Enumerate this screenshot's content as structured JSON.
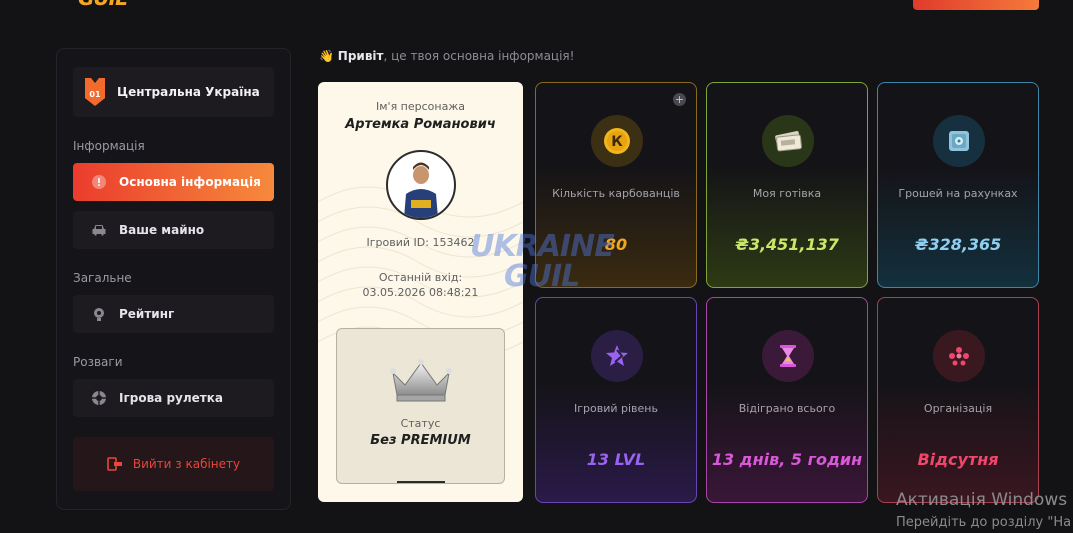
{
  "header": {
    "logo_text": "GUIL"
  },
  "sidebar": {
    "region": {
      "badge": "01",
      "name": "Центральна Україна"
    },
    "sections": [
      {
        "title": "Інформація"
      },
      {
        "title": "Загальне"
      },
      {
        "title": "Розваги"
      }
    ],
    "items": [
      {
        "label": "Основна інформація"
      },
      {
        "label": "Ваше майно"
      },
      {
        "label": "Рейтинг"
      },
      {
        "label": "Ігрова рулетка"
      }
    ],
    "logout_label": "Вийти з кабінету"
  },
  "greeting": {
    "emoji": "👋",
    "bold": "Привіт",
    "rest": ", це твоя основна інформація!"
  },
  "profile": {
    "name_label": "Ім'я персонажа",
    "name": "Артемка Романович",
    "game_id": "Ігровий ID: 153462",
    "last_login_label": "Останній вхід:",
    "last_login": "03.05.2026 08:48:21",
    "status_label": "Статус",
    "status": "Без PREMIUM"
  },
  "cards": [
    {
      "title": "Кількість карбованців",
      "value": "80",
      "icon": "coin-icon",
      "color": "#f2a71e"
    },
    {
      "title": "Моя готівка",
      "value": "₴3,451,137",
      "icon": "cash-icon",
      "color": "#c9e86a"
    },
    {
      "title": "Грошей на рахунках",
      "value": "₴328,365",
      "icon": "safe-icon",
      "color": "#8fd0f2"
    },
    {
      "title": "Ігровий рівень",
      "value": "13 LVL",
      "icon": "star-icon",
      "color": "#9a62f0"
    },
    {
      "title": "Відіграно всього",
      "value": "13 днів, 5 годин",
      "icon": "hourglass-icon",
      "color": "#d957d9"
    },
    {
      "title": "Організація",
      "value": "Відсутня",
      "icon": "organization-icon",
      "color": "#f0466c"
    }
  ],
  "watermark": {
    "line1": "UKRAINE",
    "line2": "GUIL"
  },
  "windows_activation": {
    "title": "Активація Windows",
    "subtitle": "Перейдіть до розділу \"На"
  }
}
